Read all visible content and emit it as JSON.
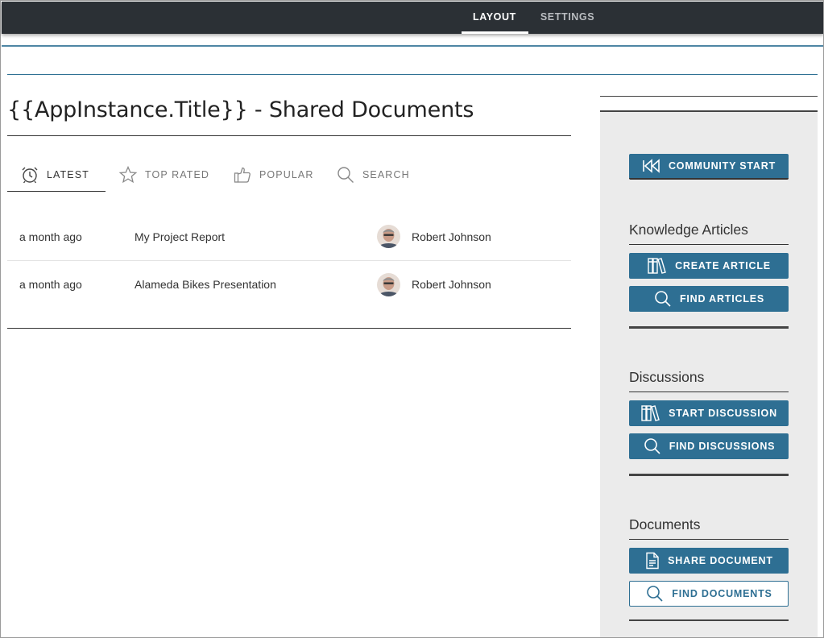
{
  "topnav": {
    "tabs": [
      {
        "label": "LAYOUT",
        "active": true
      },
      {
        "label": "SETTINGS",
        "active": false
      }
    ]
  },
  "page": {
    "title": "{{AppInstance.Title}} - Shared Documents"
  },
  "tabs": [
    {
      "label": "LATEST",
      "icon": "alarm-clock-icon",
      "active": true
    },
    {
      "label": "TOP RATED",
      "icon": "star-icon",
      "active": false
    },
    {
      "label": "POPULAR",
      "icon": "thumbs-up-icon",
      "active": false
    },
    {
      "label": "SEARCH",
      "icon": "search-icon",
      "active": false
    }
  ],
  "documents": [
    {
      "when": "a month ago",
      "name": "My Project Report",
      "author": "Robert Johnson"
    },
    {
      "when": "a month ago",
      "name": "Alameda Bikes Presentation",
      "author": "Robert Johnson"
    }
  ],
  "sidebar": {
    "community_start": "COMMUNITY START",
    "knowledge": {
      "title": "Knowledge Articles",
      "create": "CREATE ARTICLE",
      "find": "FIND ARTICLES"
    },
    "discussions": {
      "title": "Discussions",
      "start": "START DISCUSSION",
      "find": "FIND DISCUSSIONS"
    },
    "documents": {
      "title": "Documents",
      "share": "SHARE DOCUMENT",
      "find": "FIND DOCUMENTS"
    }
  },
  "colors": {
    "topbar": "#2b3035",
    "accent": "#2e6f93",
    "sidebar_bg": "#ebebeb"
  }
}
